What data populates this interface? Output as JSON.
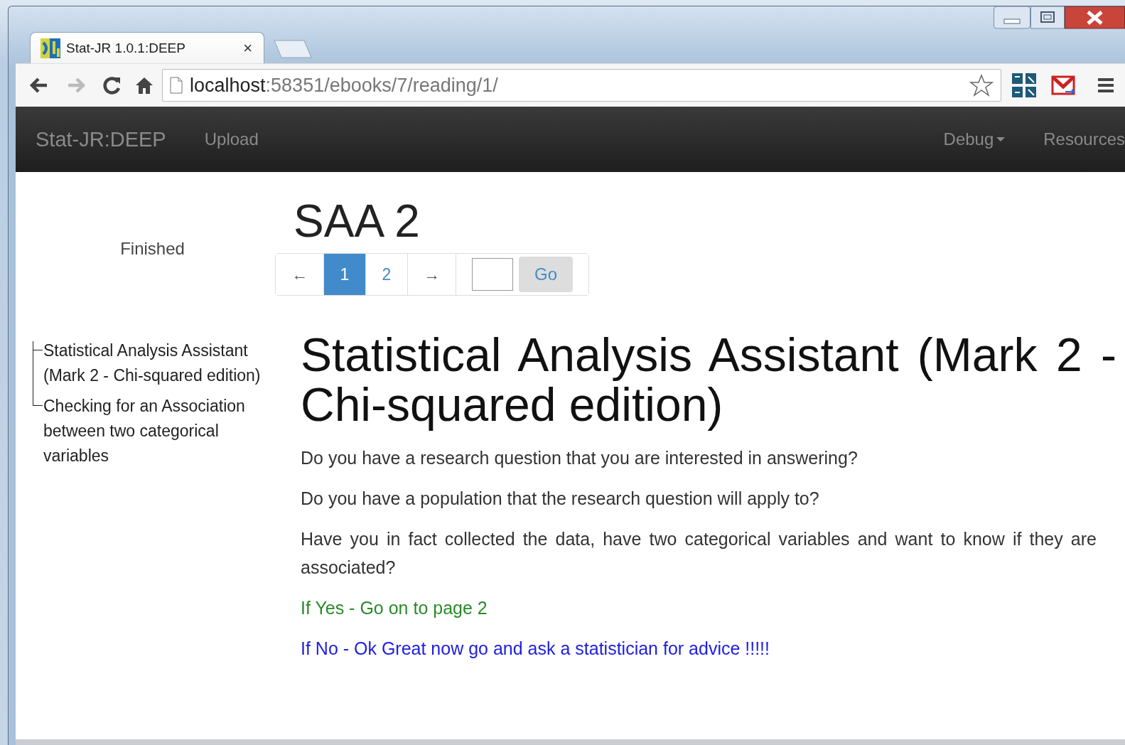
{
  "browser": {
    "tab": {
      "title": "Stat-JR 1.0.1:DEEP",
      "close": "×"
    },
    "address": {
      "host": "localhost",
      "rest": ":58351/ebooks/7/reading/1/"
    }
  },
  "navbar": {
    "brand": "Stat-JR:DEEP",
    "items": [
      {
        "label": "Upload",
        "kind": "link"
      },
      {
        "label": "Debug",
        "kind": "dropdown"
      },
      {
        "label": "Resources",
        "kind": "link"
      }
    ]
  },
  "sidebar": {
    "status": "Finished",
    "tree": [
      {
        "label": "Statistical Analysis Assistant (Mark 2 - Chi-squared edition)"
      },
      {
        "label": "Checking for an Association between two categorical variables"
      }
    ]
  },
  "main": {
    "title": "SAA 2",
    "pagination": {
      "prev": "←",
      "pages": [
        {
          "label": "1",
          "selected": true
        },
        {
          "label": "2",
          "selected": false
        }
      ],
      "next": "→",
      "go": "Go"
    },
    "heading": "Statistical Analysis Assistant (Mark 2 - Chi-squared edition)",
    "paragraphs": [
      {
        "text": "Do you have a research question that you are interested in answering?",
        "color": "#333333"
      },
      {
        "text": "Do you have a population that the research question will apply to?",
        "color": "#333333"
      },
      {
        "text": "Have you in fact collected the data, have two categorical variables and want to know if they are associated?",
        "color": "#333333"
      },
      {
        "text": "If Yes - Go on to page 2",
        "color": "#2a8a2a"
      },
      {
        "text": "If No - Ok Great now go and ask a statistician for advice !!!!!",
        "color": "#2020e0"
      }
    ]
  }
}
